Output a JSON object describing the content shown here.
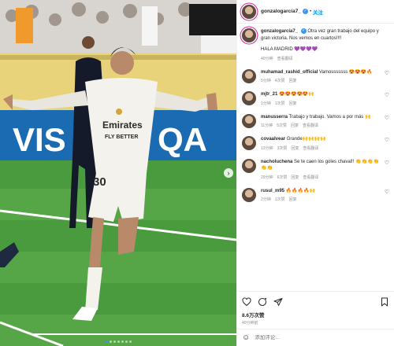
{
  "post": {
    "username": "gonzalogarcía7_",
    "follow_label": "关注",
    "separator": "•",
    "caption": {
      "username": "gonzalogarcía7_",
      "text": "Otra vez gran trabajo del equipo y gran victoria. Nos vemos en cuartos!!!!",
      "reply": "HALA MADRID 💜💜💜💜",
      "time": "40分钟",
      "translate": "查看翻译"
    },
    "photo": {
      "banner_text": "VIS",
      "banner_text_right": "QA",
      "jersey_sponsor": "Emirates FLY BETTER",
      "jersey_number": "30",
      "slide_count": 7,
      "active_slide": 0
    }
  },
  "comments": [
    {
      "username": "muhamad_rashid_official",
      "text": "Vamosssssss 😍😍😍🔥",
      "time": "5分钟",
      "likes": "4次赞",
      "reply": "回复"
    },
    {
      "username": "mjtr_21",
      "text": "😍😍😍😍😍🙌",
      "time": "1分钟",
      "likes": "1次赞",
      "reply": "回复"
    },
    {
      "username": "manusserra",
      "text": "Trabajo y trabajo. Vamos a por más 🙌",
      "time": "11分钟",
      "likes": "5次赞",
      "reply": "回复",
      "translate": "查看翻译"
    },
    {
      "username": "covaalvear",
      "text": "Grande🙌🙌🙌🙌",
      "time": "13分钟",
      "likes": "3次赞",
      "reply": "回复",
      "translate": "查看翻译"
    },
    {
      "username": "nacholuchena",
      "text": "Se te caen los goles chaval!! 👏👏👏👏👏👏",
      "time": "29分钟",
      "likes": "6次赞",
      "reply": "回复",
      "translate": "查看翻译"
    },
    {
      "username": "rusul_m95",
      "text": "🔥🔥🔥🔥🙌",
      "time": "2分钟",
      "likes": "1次赞",
      "reply": "回复"
    }
  ],
  "actions": {
    "likes": "8.6万次赞",
    "time": "40分钟前"
  },
  "add_comment": {
    "placeholder": "添加评论..."
  },
  "colors": {
    "accent": "#0095f6",
    "verified": "#3897f0",
    "story_ring": "#d6249f",
    "pitch": "#3f8a3a",
    "banner": "#1b6bb3"
  },
  "icons": {
    "like": "heart-icon",
    "comment": "comment-icon",
    "share": "send-icon",
    "save": "bookmark-icon",
    "emoji": "smiley-icon",
    "verified": "verified-badge-icon",
    "next": "chevron-right-icon"
  }
}
